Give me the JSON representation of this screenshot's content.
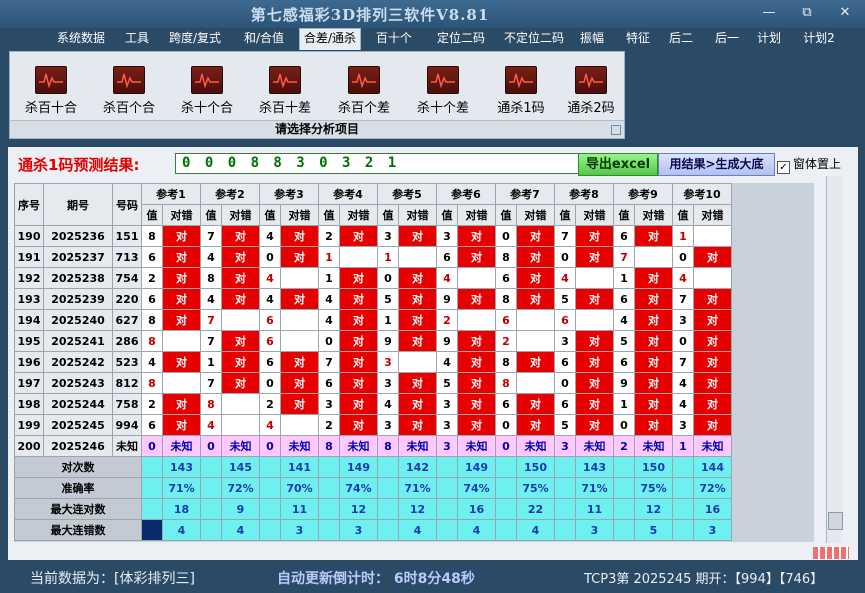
{
  "app": {
    "title": "第七感福彩3D排列三软件V8.81"
  },
  "window": {
    "minimize": "—",
    "restore": "⧉",
    "close": "✕"
  },
  "menu": [
    "系统数据",
    "工具",
    "跨度/复式",
    "和/合值",
    "合差/通杀",
    "百十个",
    "定位二码",
    "不定位二码",
    "振幅",
    "特征",
    "后二",
    "后一",
    "计划",
    "计划2"
  ],
  "active_menu_index": 4,
  "ribbon": {
    "buttons": [
      "杀百十合",
      "杀百个合",
      "杀十个合",
      "杀百十差",
      "杀百个差",
      "杀十个差",
      "通杀1码",
      "通杀2码"
    ],
    "caption": "请选择分析项目",
    "icon": "chart-pulse-icon"
  },
  "result": {
    "label": "通杀1码预测结果:",
    "value": "0 0 0 8 8 3 0 3 2 1",
    "export_label": "导出excel",
    "apply_label": "用结果>生成大底",
    "ontop_label": "窗体置上",
    "ontop_checked": "✓"
  },
  "table": {
    "headers": {
      "seq": "序号",
      "period": "期号",
      "code": "号码",
      "val": "值",
      "judge": "对错"
    },
    "refs": [
      "参考1",
      "参考2",
      "参考3",
      "参考4",
      "参考5",
      "参考6",
      "参考7",
      "参考8",
      "参考9",
      "参考10"
    ],
    "hit_text": "对",
    "rows": [
      {
        "seq": "190",
        "period": "2025236",
        "code": "151",
        "v": [
          "8",
          "7",
          "4",
          "2",
          "3",
          "3",
          "0",
          "7",
          "6",
          "1"
        ],
        "j": [
          1,
          1,
          1,
          1,
          1,
          1,
          1,
          1,
          1,
          0
        ],
        "hot": [
          0,
          0,
          0,
          0,
          0,
          0,
          0,
          0,
          0,
          1
        ]
      },
      {
        "seq": "191",
        "period": "2025237",
        "code": "713",
        "v": [
          "6",
          "4",
          "0",
          "1",
          "1",
          "6",
          "8",
          "0",
          "7",
          "0"
        ],
        "j": [
          1,
          1,
          1,
          0,
          0,
          1,
          1,
          1,
          0,
          1
        ],
        "hot": [
          0,
          0,
          0,
          1,
          1,
          0,
          0,
          0,
          1,
          0
        ]
      },
      {
        "seq": "192",
        "period": "2025238",
        "code": "754",
        "v": [
          "2",
          "8",
          "4",
          "1",
          "0",
          "4",
          "6",
          "4",
          "1",
          "4"
        ],
        "j": [
          1,
          1,
          0,
          1,
          1,
          0,
          1,
          0,
          1,
          0
        ],
        "hot": [
          0,
          0,
          1,
          0,
          0,
          1,
          0,
          1,
          0,
          1
        ]
      },
      {
        "seq": "193",
        "period": "2025239",
        "code": "220",
        "v": [
          "6",
          "4",
          "4",
          "4",
          "5",
          "9",
          "8",
          "5",
          "6",
          "7"
        ],
        "j": [
          1,
          1,
          1,
          1,
          1,
          1,
          1,
          1,
          1,
          1
        ],
        "hot": [
          0,
          0,
          0,
          0,
          0,
          0,
          0,
          0,
          0,
          0
        ]
      },
      {
        "seq": "194",
        "period": "2025240",
        "code": "627",
        "v": [
          "8",
          "7",
          "6",
          "4",
          "1",
          "2",
          "6",
          "6",
          "4",
          "3"
        ],
        "j": [
          1,
          0,
          0,
          1,
          1,
          0,
          0,
          0,
          1,
          1
        ],
        "hot": [
          0,
          1,
          1,
          0,
          0,
          1,
          1,
          1,
          0,
          0
        ]
      },
      {
        "seq": "195",
        "period": "2025241",
        "code": "286",
        "v": [
          "8",
          "7",
          "6",
          "0",
          "9",
          "9",
          "2",
          "3",
          "5",
          "0"
        ],
        "j": [
          0,
          1,
          0,
          1,
          1,
          1,
          0,
          1,
          1,
          1
        ],
        "hot": [
          1,
          0,
          1,
          0,
          0,
          0,
          1,
          0,
          0,
          0
        ]
      },
      {
        "seq": "196",
        "period": "2025242",
        "code": "523",
        "v": [
          "4",
          "1",
          "6",
          "7",
          "3",
          "4",
          "8",
          "6",
          "6",
          "7"
        ],
        "j": [
          1,
          1,
          1,
          1,
          0,
          1,
          1,
          1,
          1,
          1
        ],
        "hot": [
          0,
          0,
          0,
          0,
          1,
          0,
          0,
          0,
          0,
          0
        ]
      },
      {
        "seq": "197",
        "period": "2025243",
        "code": "812",
        "v": [
          "8",
          "7",
          "0",
          "6",
          "3",
          "5",
          "8",
          "0",
          "9",
          "4"
        ],
        "j": [
          0,
          1,
          1,
          1,
          1,
          1,
          0,
          1,
          1,
          1
        ],
        "hot": [
          1,
          0,
          0,
          0,
          0,
          0,
          1,
          0,
          0,
          0
        ]
      },
      {
        "seq": "198",
        "period": "2025244",
        "code": "758",
        "v": [
          "2",
          "8",
          "2",
          "3",
          "4",
          "3",
          "6",
          "6",
          "1",
          "4"
        ],
        "j": [
          1,
          0,
          1,
          1,
          1,
          1,
          1,
          1,
          1,
          1
        ],
        "hot": [
          0,
          1,
          0,
          0,
          0,
          0,
          0,
          0,
          0,
          0
        ]
      },
      {
        "seq": "199",
        "period": "2025245",
        "code": "994",
        "v": [
          "6",
          "4",
          "4",
          "2",
          "3",
          "3",
          "0",
          "5",
          "0",
          "3"
        ],
        "j": [
          1,
          0,
          0,
          1,
          1,
          1,
          1,
          1,
          1,
          1
        ],
        "hot": [
          0,
          1,
          1,
          0,
          0,
          0,
          0,
          0,
          0,
          0
        ]
      }
    ],
    "predict_row": {
      "seq": "200",
      "period": "2025246",
      "code": "未知",
      "v": [
        "0",
        "0",
        "0",
        "8",
        "8",
        "3",
        "0",
        "3",
        "2",
        "1"
      ],
      "unknown": "未知"
    },
    "stats": [
      {
        "label": "对次数",
        "values": [
          "143",
          "145",
          "141",
          "149",
          "142",
          "149",
          "150",
          "143",
          "150",
          "144"
        ]
      },
      {
        "label": "准确率",
        "values": [
          "71%",
          "72%",
          "70%",
          "74%",
          "71%",
          "74%",
          "75%",
          "71%",
          "75%",
          "72%"
        ]
      },
      {
        "label": "最大连对数",
        "values": [
          "18",
          "9",
          "11",
          "12",
          "12",
          "16",
          "22",
          "11",
          "12",
          "16"
        ]
      },
      {
        "label": "最大连错数",
        "values": [
          "4",
          "4",
          "3",
          "3",
          "4",
          "4",
          "4",
          "3",
          "5",
          "3"
        ]
      }
    ]
  },
  "status": {
    "current_data": "当前数据为：[体彩排列三]",
    "countdown": "自动更新倒计时：  6时8分48秒",
    "last_draw": "TCP3第  2025245  期开：【994】【746】"
  }
}
